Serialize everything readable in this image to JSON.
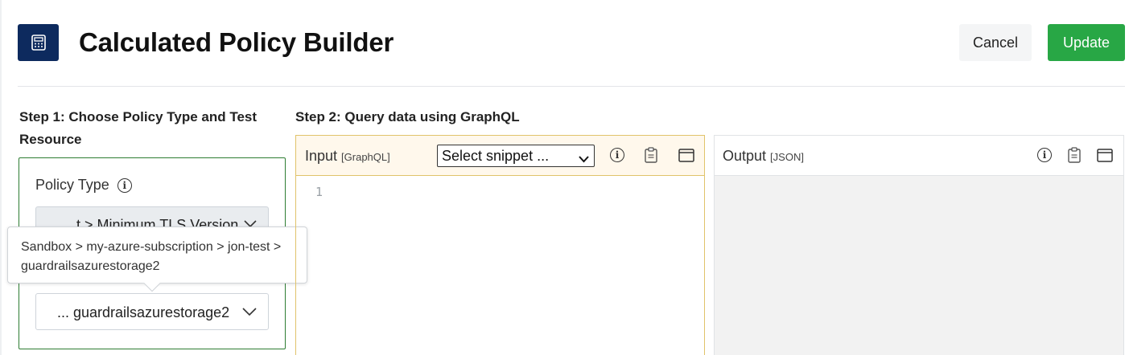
{
  "header": {
    "app_icon": "calculator-icon",
    "title": "Calculated Policy Builder",
    "cancel_label": "Cancel",
    "update_label": "Update",
    "accent_color": "#0d2a5e",
    "update_color": "#28a745"
  },
  "step1": {
    "heading": "Step 1: Choose Policy Type and Test Resource",
    "policy_type_label": "Policy Type",
    "policy_type_value": "... t > Minimum TLS Version",
    "resource_value": "... guardrailsazurestorage2",
    "tooltip_text": "Sandbox > my-azure-subscription > jon-test > guardrailsazurestorage2",
    "card_border_color": "#2e7d32"
  },
  "step2": {
    "heading": "Step 2: Query data using GraphQL",
    "input": {
      "title": "Input",
      "subtitle": "[GraphQL]",
      "snippet_selected": "Select snippet ...",
      "line_number": "1",
      "icons": [
        "info-icon",
        "clipboard-icon",
        "panel-icon"
      ]
    },
    "output": {
      "title": "Output",
      "subtitle": "[JSON]",
      "icons": [
        "info-icon",
        "clipboard-icon",
        "panel-icon"
      ]
    }
  }
}
